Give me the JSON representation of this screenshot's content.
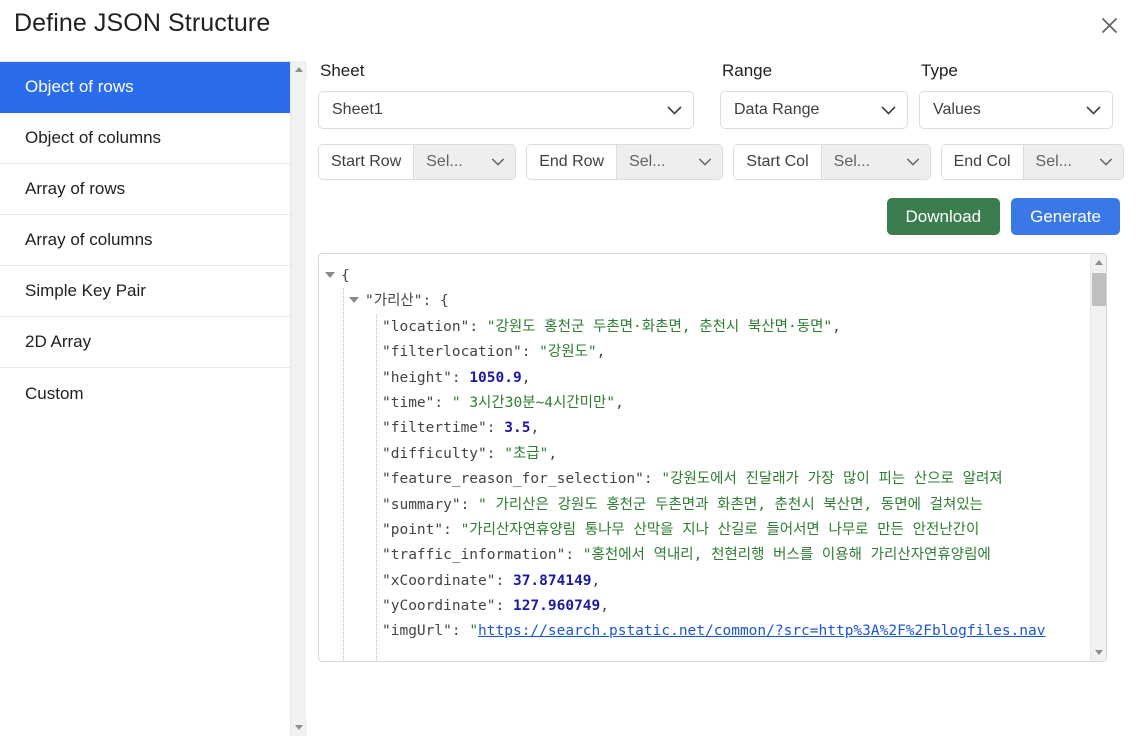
{
  "dialog": {
    "title": "Define JSON Structure",
    "close_icon": "close-icon"
  },
  "sidebar": {
    "items": [
      {
        "label": "Object of rows",
        "active": true
      },
      {
        "label": "Object of columns",
        "active": false
      },
      {
        "label": "Array of rows",
        "active": false
      },
      {
        "label": "Array of columns",
        "active": false
      },
      {
        "label": "Simple Key Pair",
        "active": false
      },
      {
        "label": "2D Array",
        "active": false
      },
      {
        "label": "Custom",
        "active": false
      }
    ],
    "scroll_up_icon": "chevron-up-icon",
    "scroll_down_icon": "chevron-down-icon"
  },
  "controls": {
    "sheet": {
      "label": "Sheet",
      "value": "Sheet1"
    },
    "range": {
      "label": "Range",
      "value": "Data Range"
    },
    "type": {
      "label": "Type",
      "value": "Values"
    },
    "start_row": {
      "label": "Start Row",
      "value": "Sel..."
    },
    "end_row": {
      "label": "End Row",
      "value": "Sel..."
    },
    "start_col": {
      "label": "Start Col",
      "value": "Sel..."
    },
    "end_col": {
      "label": "End Col",
      "value": "Sel..."
    },
    "dropdown_icon": "chevron-down-icon"
  },
  "actions": {
    "download_label": "Download",
    "generate_label": "Generate",
    "download_color": "#3b7d4f",
    "generate_color": "#3b78e7"
  },
  "json_viewer": {
    "lines": [
      {
        "indent": 0,
        "caret": true,
        "text": "{"
      },
      {
        "indent": 1,
        "caret": true,
        "key": "\"가리산\"",
        "sep": ": ",
        "text": "{"
      },
      {
        "indent": 2,
        "caret": false,
        "key": "\"location\"",
        "sep": ": ",
        "value": "\"강원도 홍천군 두촌면·화촌면, 춘천시 북산면·동면\"",
        "vtype": "str",
        "comma": true
      },
      {
        "indent": 2,
        "caret": false,
        "key": "\"filterlocation\"",
        "sep": ": ",
        "value": "\"강원도\"",
        "vtype": "str",
        "comma": true
      },
      {
        "indent": 2,
        "caret": false,
        "key": "\"height\"",
        "sep": ": ",
        "value": "1050.9",
        "vtype": "num",
        "comma": true
      },
      {
        "indent": 2,
        "caret": false,
        "key": "\"time\"",
        "sep": ": ",
        "value": "\" 3시간30분~4시간미만\"",
        "vtype": "str",
        "comma": true
      },
      {
        "indent": 2,
        "caret": false,
        "key": "\"filtertime\"",
        "sep": ": ",
        "value": "3.5",
        "vtype": "num",
        "comma": true
      },
      {
        "indent": 2,
        "caret": false,
        "key": "\"difficulty\"",
        "sep": ": ",
        "value": "\"초급\"",
        "vtype": "str",
        "comma": true
      },
      {
        "indent": 2,
        "caret": false,
        "key": "\"feature_reason_for_selection\"",
        "sep": ": ",
        "value": "\"강원도에서 진달래가 가장 많이 피는 산으로 알려져",
        "vtype": "str",
        "comma": false
      },
      {
        "indent": 2,
        "caret": false,
        "key": "\"summary\"",
        "sep": ": ",
        "value": "\" 가리산은 강원도 홍천군 두촌면과 화촌면, 춘천시 북산면, 동면에 걸쳐있는",
        "vtype": "str",
        "comma": false
      },
      {
        "indent": 2,
        "caret": false,
        "key": "\"point\"",
        "sep": ": ",
        "value": "\"가리산자연휴양림 통나무 산막을 지나 산길로 들어서면 나무로 만든 안전난간이",
        "vtype": "str",
        "comma": false
      },
      {
        "indent": 2,
        "caret": false,
        "key": "\"traffic_information\"",
        "sep": ": ",
        "value": "\"홍천에서 역내리, 천현리행 버스를 이용해 가리산자연휴양림에",
        "vtype": "str",
        "comma": false
      },
      {
        "indent": 2,
        "caret": false,
        "key": "\"xCoordinate\"",
        "sep": ": ",
        "value": "37.874149",
        "vtype": "num",
        "comma": true
      },
      {
        "indent": 2,
        "caret": false,
        "key": "\"yCoordinate\"",
        "sep": ": ",
        "value": "127.960749",
        "vtype": "num",
        "comma": true
      },
      {
        "indent": 2,
        "caret": false,
        "key": "\"imgUrl\"",
        "sep": ": ",
        "prefix": "\"",
        "link": "https://search.pstatic.net/common/?src=http%3A%2F%2Fblogfiles.nav",
        "vtype": "link",
        "comma": false
      }
    ],
    "scroll_up_icon": "chevron-up-icon",
    "scroll_down_icon": "chevron-down-icon",
    "string_color": "#2e7d32",
    "number_color": "#1a1aa6",
    "link_color": "#1a56d6"
  }
}
